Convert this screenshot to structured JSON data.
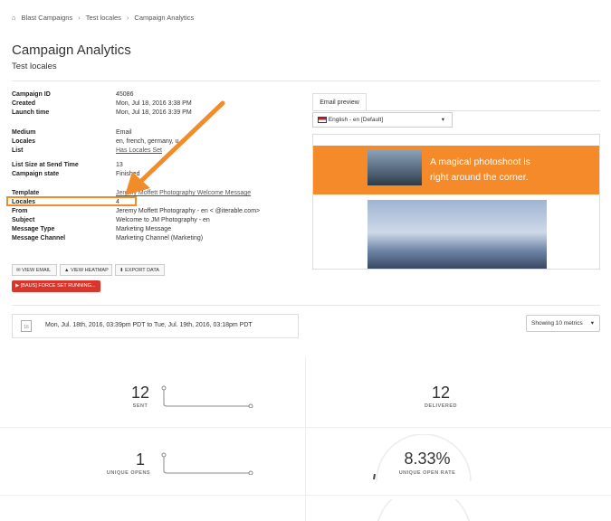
{
  "breadcrumb": {
    "items": [
      "Blast Campaigns",
      "Test locales",
      "Campaign Analytics"
    ]
  },
  "page": {
    "title": "Campaign Analytics",
    "subtitle": "Test locales"
  },
  "details": [
    {
      "key": "Campaign ID",
      "value": "45086"
    },
    {
      "key": "Created",
      "value": "Mon, Jul 18, 2016 3:38 PM"
    },
    {
      "key": "Launch time",
      "value": "Mon, Jul 18, 2016 3:39 PM"
    },
    {
      "key": "Medium",
      "value": "Email"
    },
    {
      "key": "Locales",
      "value": "en, french, germany, u"
    },
    {
      "key": "List",
      "value": "Has Locales Set"
    },
    {
      "key": "List Size at Send Time",
      "value": "13"
    },
    {
      "key": "Campaign state",
      "value": "Finished"
    },
    {
      "key": "Template",
      "value": "Jeremy Moffett Photography Welcome Message"
    },
    {
      "key": "Locales",
      "value": "4"
    },
    {
      "key": "From",
      "value": "Jeremy Moffett Photography - en <        @iterable.com>"
    },
    {
      "key": "Subject",
      "value": "Welcome to JM Photography - en"
    },
    {
      "key": "Message Type",
      "value": "Marketing Message"
    },
    {
      "key": "Message Channel",
      "value": "Marketing Channel (Marketing)"
    }
  ],
  "actions": {
    "view_email": "VIEW EMAIL",
    "view_heatmap": "VIEW HEATMAP",
    "export_data": "EXPORT DATA",
    "force": "▶ [BAUS] FORCE SET RUNNING..."
  },
  "preview": {
    "tab": "Email preview",
    "locale": "English - en [Default]",
    "banner_line1": "A magical photoshoot is",
    "banner_line2": "right around the corner."
  },
  "date_range": {
    "icon": "16",
    "text": "Mon, Jul. 18th, 2016, 03:39pm PDT to Tue, Jul. 19th, 2016, 03:18pm PDT"
  },
  "metrics_select": "Showing 10 metrics",
  "metrics": {
    "sent": {
      "value": "12",
      "label": "SENT"
    },
    "delivered": {
      "value": "12",
      "label": "DELIVERED"
    },
    "unique_opens": {
      "value": "1",
      "label": "UNIQUE OPENS"
    },
    "unique_open_rate": {
      "value": "8.33%",
      "label": "UNIQUE OPEN RATE"
    }
  },
  "colors": {
    "accent": "#f58a2a",
    "danger": "#d9352b",
    "highlight": "#f28c28"
  }
}
